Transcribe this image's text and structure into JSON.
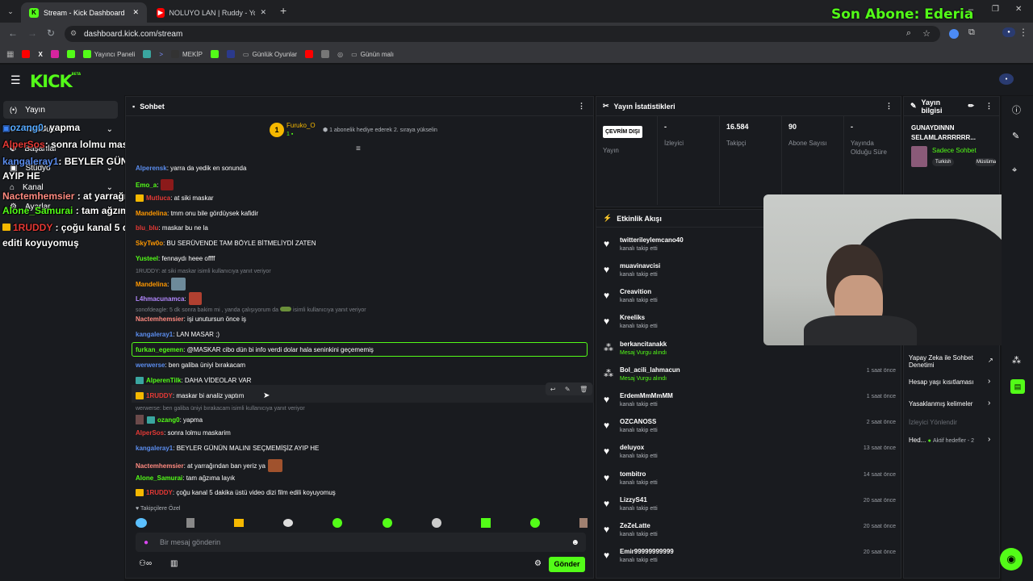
{
  "browser": {
    "tabs": [
      {
        "title": "Stream - Kick Dashboard",
        "active": true
      },
      {
        "title": "NOLUYO LAN | Ruddy - YouTube",
        "active": false
      }
    ],
    "url": "dashboard.kick.com/stream",
    "overlay_title": "Son Abone: Ederia",
    "bookmarks": [
      "Yayıncı Paneli",
      "MEKİP",
      "Günlük Oyunlar",
      "Günün malı"
    ]
  },
  "app": {
    "logo": "KICK",
    "logo_beta": "BETA",
    "sidebar": [
      {
        "label": "Yayın",
        "active": true
      },
      {
        "label": "Topluluk"
      },
      {
        "label": "Başarılar"
      },
      {
        "label": "Stüdyo"
      },
      {
        "label": "Kanal"
      },
      {
        "label": "Ayarlar"
      }
    ]
  },
  "overlay_chat": [
    {
      "user": "ozang0",
      "text": ": yapma",
      "color": "#53a8ff"
    },
    {
      "user": "AlperSos",
      "text": ": sonra lolmu maskarim",
      "color": "#e53935"
    },
    {
      "user": "kangaleray1",
      "text": ": BEYLER GÜNÜN MALINI SEÇMEMİŞİZ",
      "color": "#5b8dee"
    },
    {
      "user": "",
      "text": "AYIP HE",
      "color": "#fff"
    },
    {
      "user": "Nactemhemsier",
      "text": " : at yarrağından ban yeriz ya",
      "color": "#ff8a80"
    },
    {
      "user": "Alone_Samurai",
      "text": " : tam ağzıma layık",
      "color": "#53fc18"
    },
    {
      "user": "1RUDDY",
      "text": " : çoğu kanal 5 dakika üstü video dizi film",
      "color": "#e53935"
    },
    {
      "user": "",
      "text": "editi koyuyomuş",
      "color": "#fff"
    }
  ],
  "chat": {
    "title": "Sohbet",
    "pinned_user": "Furuko_O",
    "pinned_rank": "1",
    "pinned_note": "1 abonelik hediye ederek 2. sıraya yükselin",
    "messages": [
      {
        "user": "Alperensk",
        "text": ": yarra da yedik en sonunda",
        "color": "#5b8dee"
      },
      {
        "user": "Emo_a",
        "text": ":",
        "color": "#53fc18"
      },
      {
        "user": "Mutluca",
        "text": ": at siki maskar",
        "color": "#e53935"
      },
      {
        "user": "Mandelina",
        "text": ": tmm onu bile gördüysek kafidir",
        "color": "#ff9800"
      },
      {
        "user": "blu_blu",
        "text": ": maskar bu ne la",
        "color": "#e53935"
      },
      {
        "user": "SkyTw0o",
        "text": ": BU SERÜVENDE TAM BÖYLE BİTMELİYDİ ZATEN",
        "color": "#ff9800"
      },
      {
        "user": "Yusteel",
        "text": ": fennaydı heee offff",
        "color": "#53fc18"
      },
      {
        "user": "Mandelina",
        "text": ":",
        "color": "#ff9800"
      },
      {
        "user": "L4hmacunamca",
        "text": ":",
        "color": "#b388ff"
      },
      {
        "user": "Nactemhemsier",
        "text": ": işi unutursun önce iş",
        "color": "#ff8a80"
      },
      {
        "user": "kangaleray1",
        "text": ": LAN MASAR ;)",
        "color": "#5b8dee"
      },
      {
        "user": "furkan_egemen",
        "text": ": @MASKAR cibo dün bi info verdi dolar hala seninkini geçememiş",
        "color": "#53fc18"
      },
      {
        "user": "werwerse",
        "text": ": ben galiba üniyi bırakacam",
        "color": "#5b8dee"
      },
      {
        "user": "AlperenTilk",
        "text": ": DAHA VİDEOLAR VAR",
        "color": "#53fc18"
      },
      {
        "user": "1RUDDY",
        "text": ": maskar bi analiz yaptım",
        "color": "#e53935"
      },
      {
        "user": "ozang0",
        "text": ": yapma",
        "color": "#53fc18"
      },
      {
        "user": "AlperSos",
        "text": ": sonra lolmu maskarim",
        "color": "#e53935"
      },
      {
        "user": "kangaleray1",
        "text": ": BEYLER GÜNÜN MALINI SEÇMEMİŞİZ AYIP HE",
        "color": "#5b8dee"
      },
      {
        "user": "Nactemhemsier",
        "text": ": at yarrağından ban yeriz ya",
        "color": "#ff8a80"
      },
      {
        "user": "Alone_Samurai",
        "text": ": tam ağzıma layık",
        "color": "#53fc18"
      },
      {
        "user": "1RUDDY",
        "text": ": çoğu kanal 5 dakika üstü video dizi film edili koyuyomuş",
        "color": "#e53935"
      }
    ],
    "replies": [
      "1RUDDY: at siki maskar isimli kullanıcıya yanıt veriyor",
      "sonofdeagle: 5 dk sonra bakim mi , yanda çalışıyorum da",
      "isimli kullanıcıya yanıt veriyor",
      "werwerse: ben galiba üniyi bırakacam isimli kullanıcıya yanıt veriyor"
    ],
    "emote_label": "Takipçilere Özel",
    "input_placeholder": "Bir mesaj gönderin",
    "send_label": "Gönder"
  },
  "stats": {
    "title": "Yayın İstatistikleri",
    "status": "ÇEVRİM DIŞI",
    "status_label": "Yayın",
    "columns": [
      {
        "value": "-",
        "label": "İzleyici"
      },
      {
        "value": "16.584",
        "label": "Takipçi"
      },
      {
        "value": "90",
        "label": "Abone Sayısı"
      },
      {
        "value": "-",
        "label": "Yayında Olduğu Süre"
      }
    ]
  },
  "activity": {
    "title": "Etkinlik Akışı",
    "items": [
      {
        "name": "twitterileylemcano40",
        "action": "kanalı takip etti",
        "time": ""
      },
      {
        "name": "muavinavcisi",
        "action": "kanalı takip etti",
        "time": ""
      },
      {
        "name": "Creavition",
        "action": "kanalı takip etti",
        "time": ""
      },
      {
        "name": "Kreeliks",
        "action": "kanalı takip etti",
        "time": ""
      },
      {
        "name": "berkancitanakk",
        "action": "Mesaj Vurgu alındı",
        "time": ""
      },
      {
        "name": "Bol_acili_lahmacun",
        "action": "Mesaj Vurgu alındı",
        "time": "1 saat önce"
      },
      {
        "name": "ErdemMmMmMM",
        "action": "kanalı takip etti",
        "time": "1 saat önce"
      },
      {
        "name": "OZCANOSS",
        "action": "kanalı takip etti",
        "time": "2 saat önce"
      },
      {
        "name": "deluyox",
        "action": "kanalı takip etti",
        "time": "13 saat önce"
      },
      {
        "name": "tombitro",
        "action": "kanalı takip etti",
        "time": "14 saat önce"
      },
      {
        "name": "LizzyS41",
        "action": "kanalı takip etti",
        "time": "20 saat önce"
      },
      {
        "name": "ZeZeLatte",
        "action": "kanalı takip etti",
        "time": "20 saat önce"
      },
      {
        "name": "Emir99999999999",
        "action": "kanalı takip etti",
        "time": "20 saat önce"
      }
    ]
  },
  "info": {
    "title": "Yayın bilgisi",
    "stream_title": "GUNAYDINNN SELAMLARRRRRR...",
    "category": "Sadece Sohbet",
    "tags": [
      "Turkish",
      "Müslüma"
    ],
    "menu": [
      "Yapay Zeka ile Sohbet Denetimi",
      "Hesap yaşı kısıtlaması",
      "Yasaklanmış kelimeler",
      "İzleyici Yönlendir",
      "Hed...",
      "Aktif hedefler - 2"
    ]
  }
}
